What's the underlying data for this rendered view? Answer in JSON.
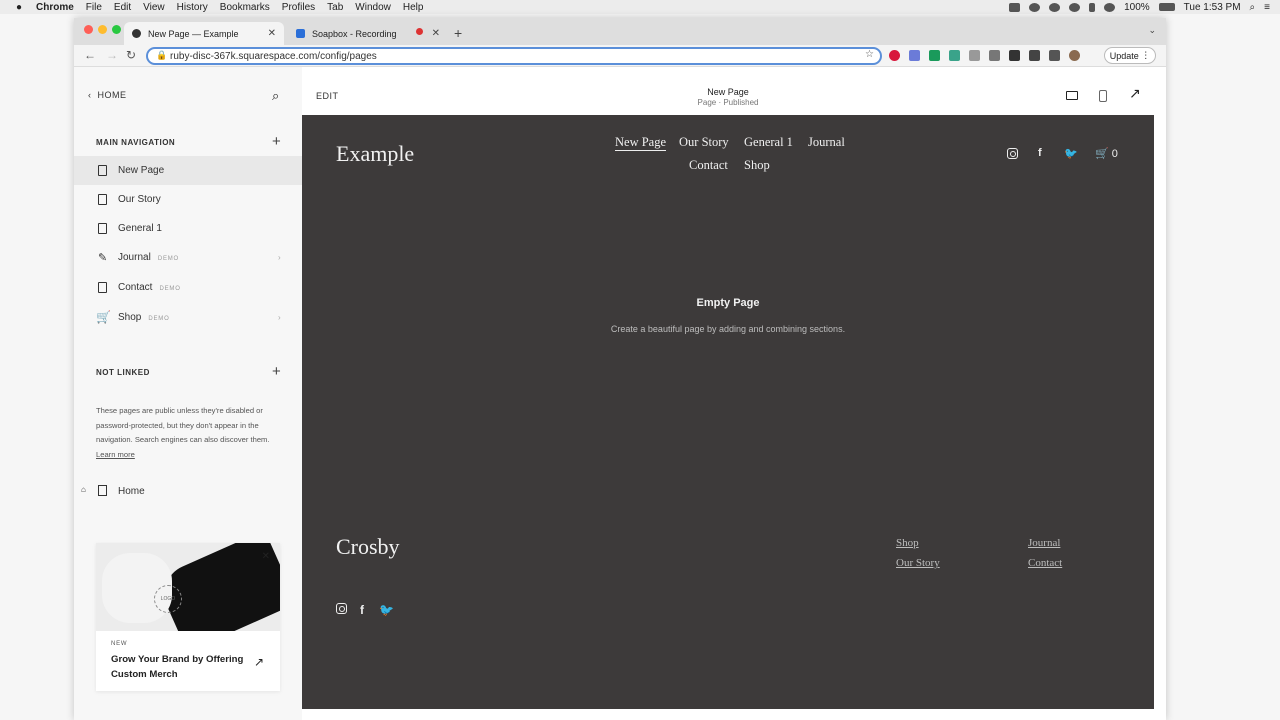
{
  "menubar": {
    "app": "Chrome",
    "items": [
      "File",
      "Edit",
      "View",
      "History",
      "Bookmarks",
      "Profiles",
      "Tab",
      "Window",
      "Help"
    ],
    "battery": "100%",
    "clock": "Tue 1:53 PM"
  },
  "tabs": [
    {
      "title": "New Page — Example",
      "active": true
    },
    {
      "title": "Soapbox - Recording",
      "active": false
    }
  ],
  "url": "ruby-disc-367k.squarespace.com/config/pages",
  "update_label": "Update",
  "sidebar": {
    "home_label": "HOME",
    "main_nav_title": "MAIN NAVIGATION",
    "main_nav": [
      {
        "label": "New Page",
        "demo": "",
        "selected": true
      },
      {
        "label": "Our Story",
        "demo": ""
      },
      {
        "label": "General 1",
        "demo": ""
      },
      {
        "label": "Journal",
        "demo": "DEMO"
      },
      {
        "label": "Contact",
        "demo": "DEMO"
      },
      {
        "label": "Shop",
        "demo": "DEMO"
      }
    ],
    "not_linked_title": "NOT LINKED",
    "not_linked_desc": "These pages are public unless they're disabled or password-protected, but they don't appear in the navigation. Search engines can also discover them.",
    "learn_more": "Learn more",
    "home_page": "Home",
    "promo": {
      "badge": "NEW",
      "title": "Grow Your Brand by Offering Custom Merch",
      "logo_text": "LOGO"
    }
  },
  "editor": {
    "edit_label": "EDIT",
    "page_title": "New Page",
    "page_status": "Page · Published"
  },
  "site": {
    "logo": "Example",
    "nav": [
      "New Page",
      "Our Story",
      "General 1",
      "Journal",
      "Contact",
      "Shop"
    ],
    "cart_count": "0",
    "empty_title": "Empty Page",
    "empty_subtitle": "Create a beautiful page by adding and combining sections.",
    "footer_logo": "Crosby",
    "footer_links": [
      "Shop",
      "Our Story",
      "Journal",
      "Contact"
    ]
  }
}
